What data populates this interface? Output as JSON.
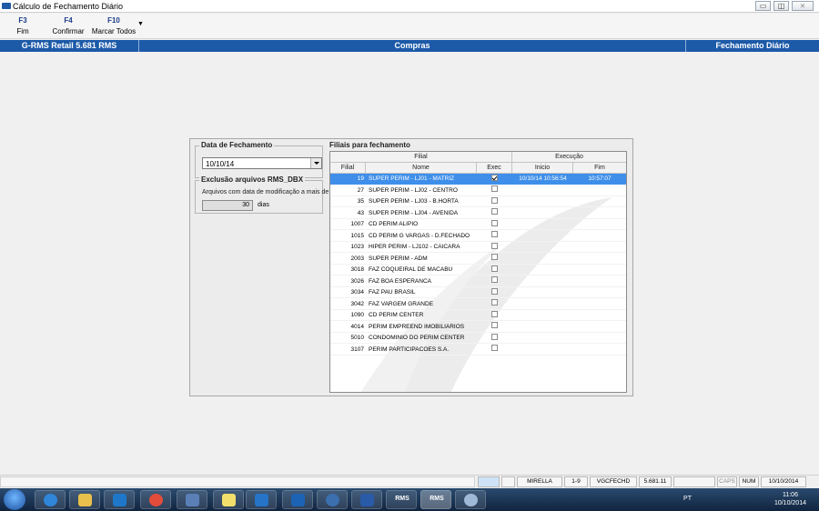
{
  "window": {
    "title": "Cálculo de Fechamento Diário",
    "minimize": "▭",
    "maximize": "◫",
    "close": "⨯"
  },
  "fkeys": [
    {
      "key": "F3",
      "label": "Fim"
    },
    {
      "key": "F4",
      "label": "Confirmar"
    },
    {
      "key": "F10",
      "label": "Marcar Todos"
    }
  ],
  "fkeys_more": "▼",
  "header_bar": {
    "product": "G-RMS Retail 5.681 RMS",
    "module": "Compras",
    "screen": "Fechamento Diário"
  },
  "data_fechamento": {
    "title": "Data de Fechamento",
    "value": "10/10/14"
  },
  "exclusao": {
    "title": "Exclusão arquivos RMS_DBX",
    "text": "Arquivos com data de modificação a mais de",
    "days_value": "30",
    "days_label": "dias"
  },
  "filiais": {
    "title": "Filiais para fechamento",
    "group_filial": "Filial",
    "group_execucao": "Execução",
    "col_filial": "Filial",
    "col_nome": "Nome",
    "col_exec": "Exec",
    "col_inicio": "Inicio",
    "col_fim": "Fim",
    "rows": [
      {
        "filial": "19",
        "nome": "SUPER PERIM - LJ01 - MATRIZ",
        "exec": true,
        "inicio": "10/10/14 10:56:54",
        "fim": "10:57:07"
      },
      {
        "filial": "27",
        "nome": "SUPER PERIM - LJ02 - CENTRO",
        "exec": false,
        "inicio": "",
        "fim": ""
      },
      {
        "filial": "35",
        "nome": "SUPER PERIM - LJ03 - B.HORTA",
        "exec": false,
        "inicio": "",
        "fim": ""
      },
      {
        "filial": "43",
        "nome": "SUPER PERIM - LJ04 - AVENIDA",
        "exec": false,
        "inicio": "",
        "fim": ""
      },
      {
        "filial": "1007",
        "nome": "CD PERIM ALIPIO",
        "exec": false,
        "inicio": "",
        "fim": ""
      },
      {
        "filial": "1015",
        "nome": "CD PERIM G VARGAS - D.FECHADO",
        "exec": false,
        "inicio": "",
        "fim": ""
      },
      {
        "filial": "1023",
        "nome": "HIPER PERIM - LJ102 - CAICARA",
        "exec": false,
        "inicio": "",
        "fim": ""
      },
      {
        "filial": "2003",
        "nome": "SUPER PERIM - ADM",
        "exec": false,
        "inicio": "",
        "fim": ""
      },
      {
        "filial": "3018",
        "nome": "FAZ COQUEIRAL DE MACABU",
        "exec": false,
        "inicio": "",
        "fim": ""
      },
      {
        "filial": "3026",
        "nome": "FAZ BOA ESPERANCA",
        "exec": false,
        "inicio": "",
        "fim": ""
      },
      {
        "filial": "3034",
        "nome": "FAZ PAU BRASIL",
        "exec": false,
        "inicio": "",
        "fim": ""
      },
      {
        "filial": "3042",
        "nome": "FAZ VARGEM GRANDE",
        "exec": false,
        "inicio": "",
        "fim": ""
      },
      {
        "filial": "1090",
        "nome": "CD PERIM CENTER",
        "exec": false,
        "inicio": "",
        "fim": ""
      },
      {
        "filial": "4014",
        "nome": "PERIM EMPREEND IMOBILIARIOS",
        "exec": false,
        "inicio": "",
        "fim": ""
      },
      {
        "filial": "5010",
        "nome": "CONDOMINIO DO PERIM CENTER",
        "exec": false,
        "inicio": "",
        "fim": ""
      },
      {
        "filial": "3107",
        "nome": "PERIM PARTICIPACOES S.A.",
        "exec": false,
        "inicio": "",
        "fim": ""
      }
    ]
  },
  "statusbar": {
    "user": "MIRELLA",
    "range": "1-9",
    "program": "VGCFECHD",
    "version": "5.681.11",
    "caps": "CAPS",
    "num": "NUM",
    "date": "10/10/2014"
  },
  "taskbar": {
    "rms1": "RMS",
    "rms2": "RMS",
    "lang": "PT",
    "time": "11:06",
    "date": "10/10/2014"
  },
  "colors": {
    "accent_blue": "#1c5aa8",
    "selection": "#3f8fea"
  }
}
